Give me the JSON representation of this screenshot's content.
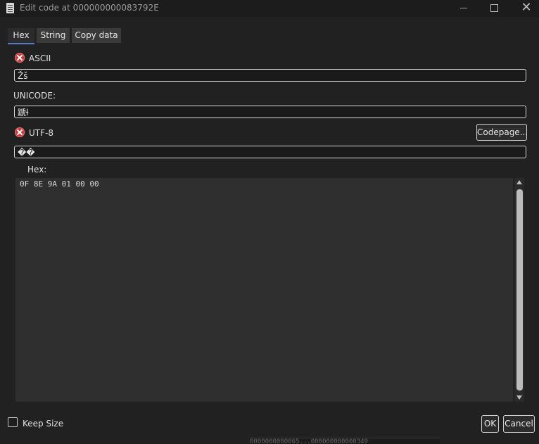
{
  "window": {
    "title": "Edit code at 000000000083792E"
  },
  "tabs": [
    {
      "label": "Hex"
    },
    {
      "label": "String"
    },
    {
      "label": "Copy data"
    }
  ],
  "ascii": {
    "label": "ASCII",
    "value": "Žš"
  },
  "unicode": {
    "label": "UNICODE:",
    "value": "蹏ƚ"
  },
  "utf8": {
    "label": "UTF-8",
    "value": "��",
    "codepage_button": "Codepage..."
  },
  "hex": {
    "label": "Hex:",
    "value": "0F 8E 9A 01 00 00"
  },
  "keep_size": {
    "label": "Keep Size"
  },
  "buttons": {
    "ok": "OK",
    "cancel": "Cancel"
  },
  "background_strip": "0000000000065...000000000000349"
}
